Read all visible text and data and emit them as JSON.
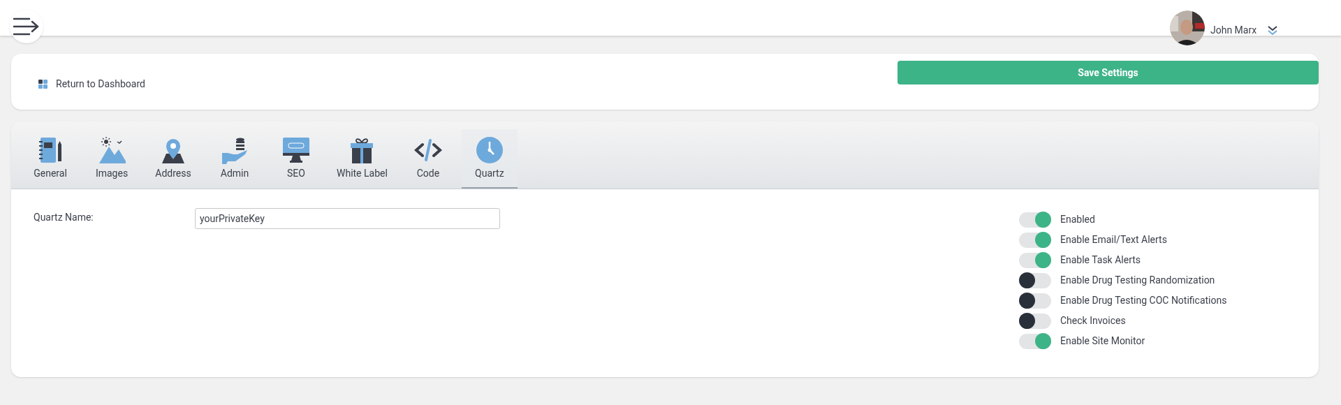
{
  "user": {
    "name": "John Marx"
  },
  "toolbar": {
    "return_link": "Return to Dashboard",
    "save_button": "Save Settings"
  },
  "tabs": [
    {
      "label": "General",
      "kind": "notebook",
      "selected": false
    },
    {
      "label": "Images",
      "kind": "mountains",
      "selected": false
    },
    {
      "label": "Address",
      "kind": "pin",
      "selected": false
    },
    {
      "label": "Admin",
      "kind": "hand",
      "selected": false
    },
    {
      "label": "SEO",
      "kind": "monitor",
      "selected": false
    },
    {
      "label": "White Label",
      "kind": "gift",
      "selected": false
    },
    {
      "label": "Code",
      "kind": "code",
      "selected": false
    },
    {
      "label": "Quartz",
      "kind": "clock",
      "selected": true
    }
  ],
  "form": {
    "label": "Quartz Name:",
    "value": "yourPrivateKey"
  },
  "toggles": [
    {
      "label": "Enabled",
      "on": true
    },
    {
      "label": "Enable Email/Text Alerts",
      "on": true
    },
    {
      "label": "Enable Task Alerts",
      "on": true
    },
    {
      "label": "Enable Drug Testing Randomization",
      "on": false
    },
    {
      "label": "Enable Drug Testing COC Notifications",
      "on": false
    },
    {
      "label": "Check Invoices",
      "on": false
    },
    {
      "label": "Enable Site Monitor",
      "on": true
    }
  ]
}
